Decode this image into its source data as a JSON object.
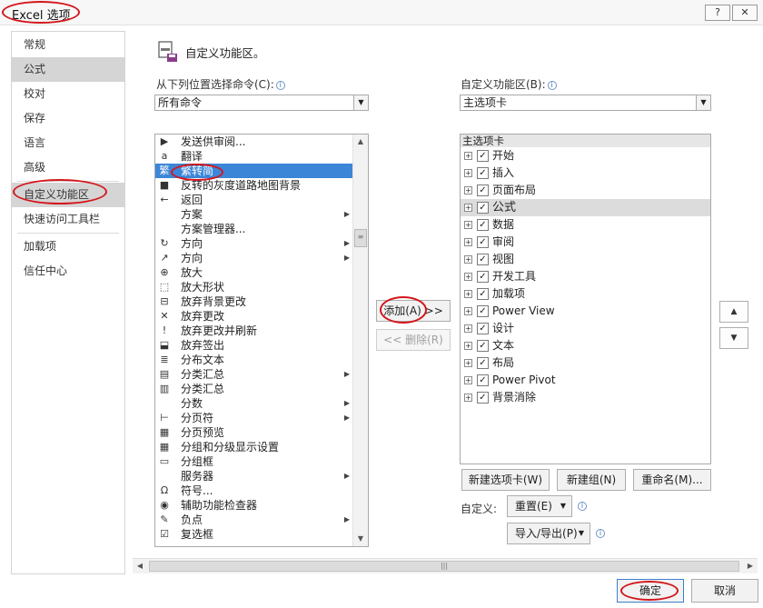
{
  "window": {
    "title": "Excel 选项",
    "help_btn": "?",
    "close_btn": "✕"
  },
  "sidebar": {
    "items": [
      {
        "label": "常规"
      },
      {
        "label": "公式"
      },
      {
        "label": "校对"
      },
      {
        "label": "保存"
      },
      {
        "label": "语言"
      },
      {
        "label": "高级"
      },
      {
        "label": "自定义功能区"
      },
      {
        "label": "快速访问工具栏"
      },
      {
        "label": "加载项"
      },
      {
        "label": "信任中心"
      }
    ]
  },
  "main": {
    "section_title": "自定义功能区。",
    "choose_from_label": "从下列位置选择命令(C):",
    "choose_from_value": "所有命令",
    "customize_label": "自定义功能区(B):",
    "customize_value": "主选项卡",
    "commands": [
      {
        "icon": "▶",
        "label": "发送供审阅...",
        "submenu": ""
      },
      {
        "icon": "a",
        "label": "翻译",
        "submenu": ""
      },
      {
        "icon": "繁",
        "label": "繁转简",
        "submenu": ""
      },
      {
        "icon": "■",
        "label": "反转的灰度道路地图背景",
        "submenu": ""
      },
      {
        "icon": "←",
        "label": "返回",
        "submenu": ""
      },
      {
        "icon": "",
        "label": "方案",
        "submenu": "▶"
      },
      {
        "icon": "",
        "label": "方案管理器...",
        "submenu": ""
      },
      {
        "icon": "↻",
        "label": "方向",
        "submenu": "▶"
      },
      {
        "icon": "↗",
        "label": "方向",
        "submenu": "▶"
      },
      {
        "icon": "⊕",
        "label": "放大",
        "submenu": ""
      },
      {
        "icon": "⬚",
        "label": "放大形状",
        "submenu": ""
      },
      {
        "icon": "⊟",
        "label": "放弃背景更改",
        "submenu": ""
      },
      {
        "icon": "✕",
        "label": "放弃更改",
        "submenu": ""
      },
      {
        "icon": "!",
        "label": "放弃更改并刷新",
        "submenu": ""
      },
      {
        "icon": "⬓",
        "label": "放弃签出",
        "submenu": ""
      },
      {
        "icon": "≣",
        "label": "分布文本",
        "submenu": ""
      },
      {
        "icon": "▤",
        "label": "分类汇总",
        "submenu": "▶"
      },
      {
        "icon": "▥",
        "label": "分类汇总",
        "submenu": ""
      },
      {
        "icon": "",
        "label": "分数",
        "submenu": "▶"
      },
      {
        "icon": "⊢",
        "label": "分页符",
        "submenu": "▶"
      },
      {
        "icon": "▦",
        "label": "分页预览",
        "submenu": ""
      },
      {
        "icon": "▦",
        "label": "分组和分级显示设置",
        "submenu": ""
      },
      {
        "icon": "▭",
        "label": "分组框",
        "submenu": ""
      },
      {
        "icon": "",
        "label": "服务器",
        "submenu": "▶"
      },
      {
        "icon": "Ω",
        "label": "符号...",
        "submenu": ""
      },
      {
        "icon": "◉",
        "label": "辅助功能检查器",
        "submenu": ""
      },
      {
        "icon": "✎",
        "label": "负点",
        "submenu": "▶"
      },
      {
        "icon": "☑",
        "label": "复选框",
        "submenu": ""
      }
    ],
    "add_button": "添加(A) >>",
    "remove_button": "<< 删除(R)",
    "tree_header": "主选项卡",
    "tabs": [
      {
        "label": "开始",
        "checked": "✓"
      },
      {
        "label": "插入",
        "checked": "✓"
      },
      {
        "label": "页面布局",
        "checked": "✓"
      },
      {
        "label": "公式",
        "checked": "✓"
      },
      {
        "label": "数据",
        "checked": "✓"
      },
      {
        "label": "审阅",
        "checked": "✓"
      },
      {
        "label": "视图",
        "checked": "✓"
      },
      {
        "label": "开发工具",
        "checked": "✓"
      },
      {
        "label": "加载项",
        "checked": "✓"
      },
      {
        "label": "Power View",
        "checked": "✓"
      },
      {
        "label": "设计",
        "checked": "✓"
      },
      {
        "label": "文本",
        "checked": "✓"
      },
      {
        "label": "布局",
        "checked": "✓"
      },
      {
        "label": "Power Pivot",
        "checked": "✓"
      },
      {
        "label": "背景消除",
        "checked": "✓"
      }
    ],
    "expand_glyph": "+",
    "move_up": "▲",
    "move_down": "▼",
    "new_tab_button": "新建选项卡(W)",
    "new_group_button": "新建组(N)",
    "rename_button": "重命名(M)...",
    "customizations_label": "自定义:",
    "reset_button": "重置(E)",
    "import_export_button": "导入/导出(P)"
  },
  "footer": {
    "ok": "确定",
    "cancel": "取消"
  },
  "colors": {
    "selection_blue": "#3c86d8",
    "annotation_red": "#d3161c"
  }
}
